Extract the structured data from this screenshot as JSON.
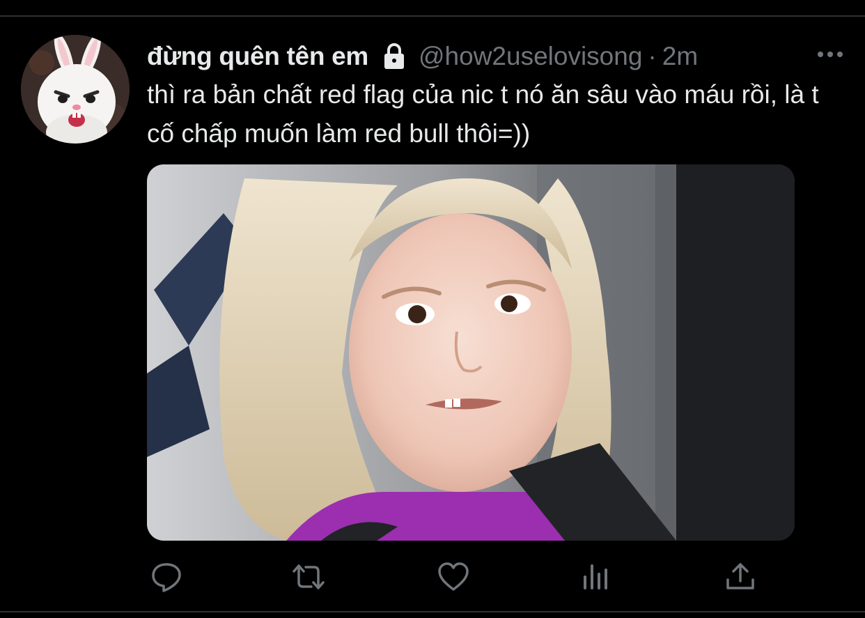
{
  "tweet": {
    "display_name": "đừng quên tên em",
    "handle": "@how2uselovisong",
    "separator": "·",
    "timestamp": "2m",
    "text": "thì ra bản chất red flag của nic t nó ăn sâu vào máu rồi, là t cố chấp muốn làm red bull thôi=))",
    "protected_icon": "lock-icon",
    "more_icon": "more-horizontal-icon"
  },
  "media": {
    "description_icon": "photo",
    "has_image": true
  },
  "actions": [
    {
      "name": "reply",
      "icon": "reply-icon"
    },
    {
      "name": "retweet",
      "icon": "retweet-icon"
    },
    {
      "name": "like",
      "icon": "heart-icon"
    },
    {
      "name": "analytics",
      "icon": "analytics-icon"
    },
    {
      "name": "share",
      "icon": "share-icon"
    }
  ],
  "colors": {
    "background": "#000000",
    "primary_text": "#e7e9ea",
    "secondary_text": "#71767b",
    "divider": "#2f3336"
  }
}
